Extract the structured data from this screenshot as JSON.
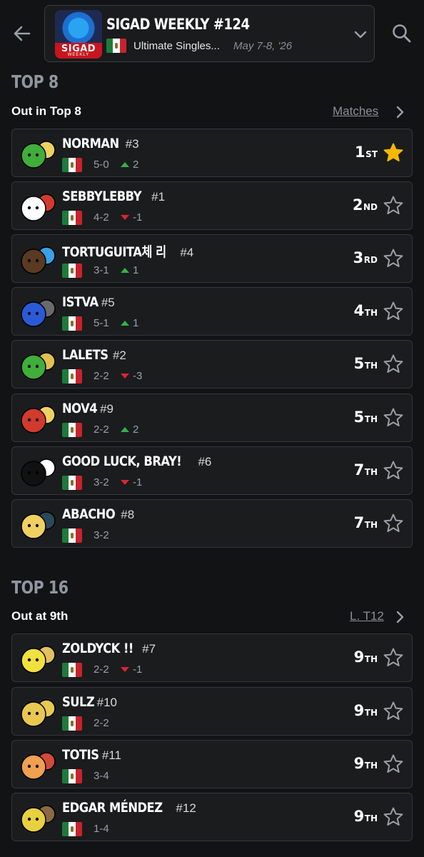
{
  "header": {
    "event_title": "SIGAD WEEKLY #124",
    "logo_text": "SIGAD",
    "logo_subtext": "WEEKLY",
    "game": "Ultimate Singles...",
    "dates": "May 7-8, '26",
    "flag_icon": "mexico-flag-icon"
  },
  "sections": [
    {
      "title": "TOP 8",
      "subtitle": "Out in Top 8",
      "link_label": "Matches",
      "rows": [
        {
          "name": "NORMAN",
          "seed": "#3",
          "record": "5-0",
          "delta": "2",
          "trend": "up",
          "place": "1",
          "suffix": "ST",
          "starred": true
        },
        {
          "name": "SEBBYLEBBY",
          "seed": "#1",
          "record": "4-2",
          "delta": "-1",
          "trend": "down",
          "place": "2",
          "suffix": "ND",
          "starred": false
        },
        {
          "name": "TORTUGUITA체 리",
          "seed": "#4",
          "record": "3-1",
          "delta": "1",
          "trend": "up",
          "place": "3",
          "suffix": "RD",
          "starred": false
        },
        {
          "name": "ISTVA",
          "seed": "#5",
          "record": "5-1",
          "delta": "1",
          "trend": "up",
          "place": "4",
          "suffix": "TH",
          "starred": false
        },
        {
          "name": "LALETS",
          "seed": "#2",
          "record": "2-2",
          "delta": "-3",
          "trend": "down",
          "place": "5",
          "suffix": "TH",
          "starred": false
        },
        {
          "name": "NOV4",
          "seed": "#9",
          "record": "2-2",
          "delta": "2",
          "trend": "up",
          "place": "5",
          "suffix": "TH",
          "starred": false
        },
        {
          "name": "GOOD LUCK, BRAY!",
          "seed": "#6",
          "record": "3-2",
          "delta": "-1",
          "trend": "down",
          "place": "7",
          "suffix": "TH",
          "starred": false
        },
        {
          "name": "ABACHO",
          "seed": "#8",
          "record": "3-2",
          "delta": "",
          "trend": "",
          "place": "7",
          "suffix": "TH",
          "starred": false
        }
      ]
    },
    {
      "title": "TOP 16",
      "subtitle": "Out at 9th",
      "link_label": "L. T12",
      "rows": [
        {
          "name": "ZOLDYCK !!",
          "seed": "#7",
          "record": "2-2",
          "delta": "-1",
          "trend": "down",
          "place": "9",
          "suffix": "TH",
          "starred": false
        },
        {
          "name": "SULZ",
          "seed": "#10",
          "record": "2-2",
          "delta": "",
          "trend": "",
          "place": "9",
          "suffix": "TH",
          "starred": false
        },
        {
          "name": "TOTIS",
          "seed": "#11",
          "record": "3-4",
          "delta": "",
          "trend": "",
          "place": "9",
          "suffix": "TH",
          "starred": false
        },
        {
          "name": "EDGAR MÉNDEZ",
          "seed": "#12",
          "record": "1-4",
          "delta": "",
          "trend": "",
          "place": "9",
          "suffix": "TH",
          "starred": false
        }
      ]
    }
  ],
  "colors": {
    "background": "#121314",
    "card": "#1b1c1e",
    "section_title": "#8f96a2",
    "star_active": "#f5b800",
    "up": "#2fb34a",
    "down": "#d8262e"
  }
}
